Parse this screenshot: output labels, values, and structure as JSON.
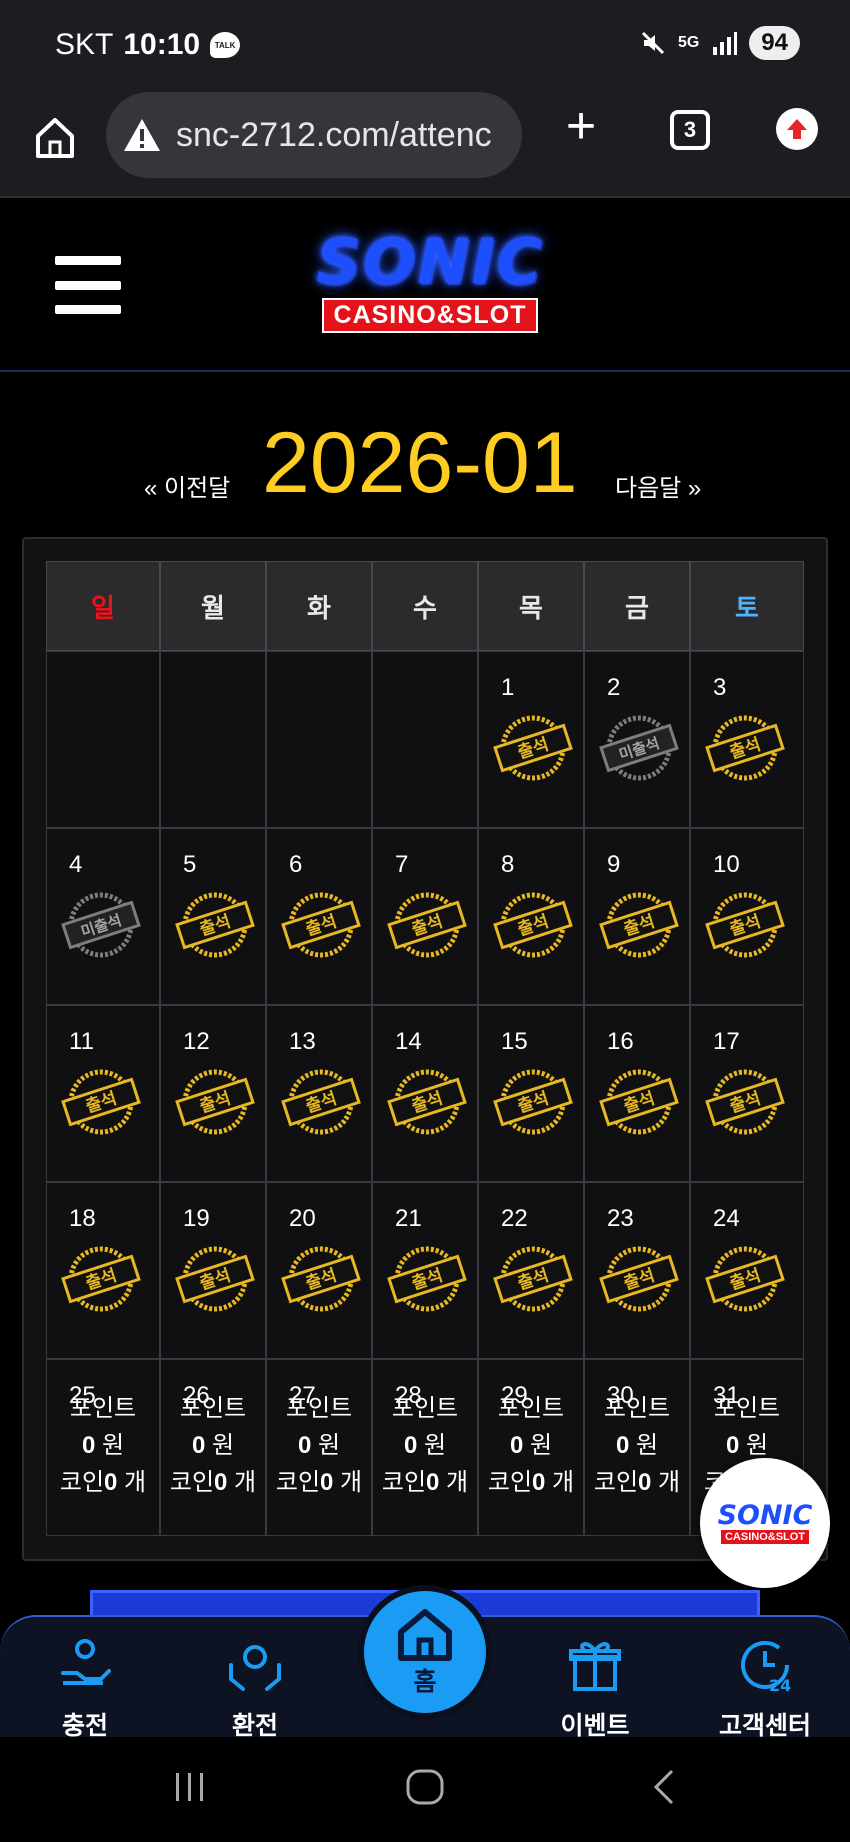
{
  "status_bar": {
    "carrier": "SKT",
    "time": "10:10",
    "talk_badge": "TALK",
    "network": "5G",
    "battery": "94"
  },
  "browser": {
    "url": "snc-2712.com/attenc",
    "tab_count": "3"
  },
  "site": {
    "logo_main": "SONIC",
    "logo_sub": "CASINO&SLOT"
  },
  "month_nav": {
    "prev": "« 이전달",
    "title": "2026-01",
    "next": "다음달 »"
  },
  "calendar": {
    "weekdays": [
      "일",
      "월",
      "화",
      "수",
      "목",
      "금",
      "토"
    ],
    "weekday_colors": {
      "sun": "#e8141c",
      "sat": "#4fb3ff",
      "default": "#e8e8e8"
    },
    "stamp_attended": "출석",
    "stamp_missed": "미출석",
    "weeks": [
      [
        {
          "day": ""
        },
        {
          "day": ""
        },
        {
          "day": ""
        },
        {
          "day": ""
        },
        {
          "day": "1",
          "status": "attended"
        },
        {
          "day": "2",
          "status": "missed"
        },
        {
          "day": "3",
          "status": "attended"
        }
      ],
      [
        {
          "day": "4",
          "status": "missed"
        },
        {
          "day": "5",
          "status": "attended"
        },
        {
          "day": "6",
          "status": "attended"
        },
        {
          "day": "7",
          "status": "attended"
        },
        {
          "day": "8",
          "status": "attended"
        },
        {
          "day": "9",
          "status": "attended"
        },
        {
          "day": "10",
          "status": "attended"
        }
      ],
      [
        {
          "day": "11",
          "status": "attended"
        },
        {
          "day": "12",
          "status": "attended"
        },
        {
          "day": "13",
          "status": "attended"
        },
        {
          "day": "14",
          "status": "attended"
        },
        {
          "day": "15",
          "status": "attended"
        },
        {
          "day": "16",
          "status": "attended"
        },
        {
          "day": "17",
          "status": "attended"
        }
      ],
      [
        {
          "day": "18",
          "status": "attended"
        },
        {
          "day": "19",
          "status": "attended"
        },
        {
          "day": "20",
          "status": "attended"
        },
        {
          "day": "21",
          "status": "attended"
        },
        {
          "day": "22",
          "status": "attended"
        },
        {
          "day": "23",
          "status": "attended"
        },
        {
          "day": "24",
          "status": "attended"
        }
      ]
    ],
    "last_week_days": [
      "25",
      "26",
      "27",
      "28",
      "29",
      "30",
      "31"
    ],
    "points_label": "포인트",
    "won_value": "0",
    "won_unit": " 원",
    "coin_label": "코인",
    "coin_value": "0",
    "coin_unit": " 개"
  },
  "bottom_nav": {
    "charge": "충전",
    "exchange": "환전",
    "home": "홈",
    "event": "이벤트",
    "support": "고객센터"
  },
  "colors": {
    "accent_gold": "#ffcc22",
    "stamp_gold": "#e7b822",
    "brand_blue": "#1e4fff",
    "nav_blue": "#1a9cf5"
  }
}
